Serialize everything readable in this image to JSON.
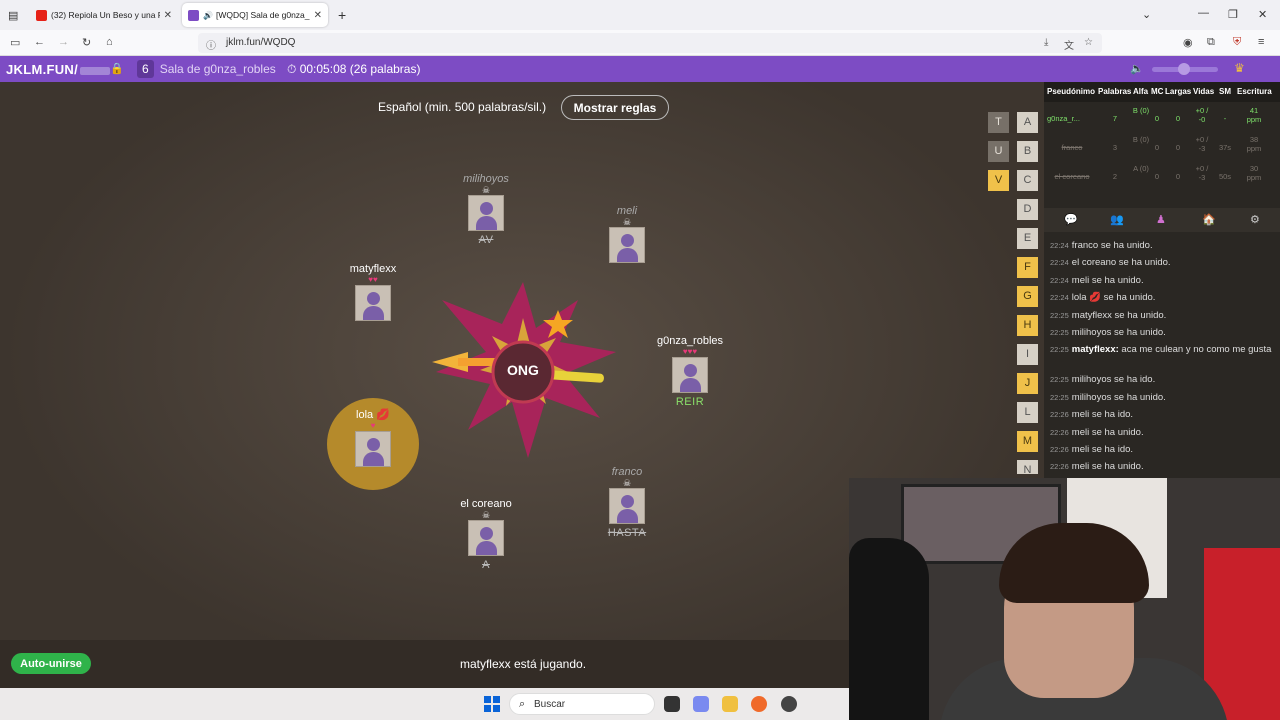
{
  "browser": {
    "tabs": [
      {
        "title": "(32) Repiola Un Beso y una Flor",
        "favicon_color": "#e62117",
        "active": false
      },
      {
        "title": "[WQDQ] Sala de g0nza_robles",
        "favicon_color": "#7d4cc4",
        "active": true
      }
    ],
    "url": "jklm.fun/WQDQ"
  },
  "gamebar": {
    "brand": "JKLM.FUN/",
    "player_count": "6",
    "room_name": "Sala de g0nza_robles",
    "timer": "00:05:08 (26 palabras)"
  },
  "game": {
    "language_label": "Español (min. 500 palabras/sil.)",
    "rules_button": "Mostrar reglas",
    "syllable": "ONG",
    "players": [
      {
        "name": "milihoyos",
        "dead": true,
        "hearts": "",
        "word": "AV"
      },
      {
        "name": "meli",
        "dead": true,
        "hearts": "",
        "word": ""
      },
      {
        "name": "matyflexx",
        "dead": false,
        "hearts": "♥♥",
        "word": ""
      },
      {
        "name": "g0nza_robles",
        "dead": false,
        "hearts": "♥♥♥",
        "word": "REIR"
      },
      {
        "name": "lola 💋",
        "dead": false,
        "hearts": "♥",
        "word": ""
      },
      {
        "name": "franco",
        "dead": true,
        "hearts": "",
        "word": "HASTA"
      },
      {
        "name": "el coreano",
        "dead": true,
        "hearts": "",
        "word": "A"
      }
    ],
    "letters_col1": [
      "T",
      "U",
      "V"
    ],
    "letters_col2": [
      "A",
      "B",
      "C",
      "D",
      "E",
      "F",
      "G",
      "H",
      "I",
      "J",
      "L",
      "M",
      "N"
    ],
    "used_col1": [
      "V"
    ],
    "used_col2": [
      "F",
      "G",
      "H",
      "J",
      "M"
    ],
    "autojoin": "Auto-unirse",
    "status": "matyflexx está jugando."
  },
  "scoreboard": {
    "headers": [
      "Pseudónimo",
      "Palabras",
      "Alfa",
      "MC",
      "Largas",
      "Vidas",
      "SM",
      "Escritura"
    ],
    "rows": [
      {
        "name": "g0nza_r...",
        "words": "7",
        "alpha": "B (0)",
        "mc": "0",
        "long": "0",
        "lives": "+0 / -0",
        "sm": "-",
        "speed": "41 ppm",
        "me": true
      },
      {
        "name": "franco",
        "words": "3",
        "alpha": "B (0)",
        "mc": "0",
        "long": "0",
        "lives": "+0 / -3",
        "sm": "37s",
        "speed": "38 ppm",
        "me": false
      },
      {
        "name": "el coreano",
        "words": "2",
        "alpha": "A (0)",
        "mc": "0",
        "long": "0",
        "lives": "+0 / -3",
        "sm": "50s",
        "speed": "30 ppm",
        "me": false
      }
    ]
  },
  "chat": [
    {
      "time": "22:24",
      "user": "",
      "text": "franco se ha unido."
    },
    {
      "time": "22:24",
      "user": "",
      "text": "el coreano se ha unido."
    },
    {
      "time": "22:24",
      "user": "",
      "text": "meli se ha unido."
    },
    {
      "time": "22:24",
      "user": "",
      "text": "lola 💋 se ha unido."
    },
    {
      "time": "22:25",
      "user": "",
      "text": "matyflexx se ha unido."
    },
    {
      "time": "22:25",
      "user": "",
      "text": "milihoyos  se ha unido."
    },
    {
      "time": "22:25",
      "user": "matyflexx:",
      "text": " aca me culean y no como me gusta"
    },
    {
      "time": "22:25",
      "user": "",
      "text": "milihoyos  se ha ido."
    },
    {
      "time": "22:25",
      "user": "",
      "text": "milihoyos  se ha unido."
    },
    {
      "time": "22:26",
      "user": "",
      "text": "meli se ha ido."
    },
    {
      "time": "22:26",
      "user": "",
      "text": "meli se ha unido."
    },
    {
      "time": "22:26",
      "user": "",
      "text": "meli se ha ido."
    },
    {
      "time": "22:26",
      "user": "",
      "text": "meli se ha unido."
    }
  ],
  "taskbar": {
    "search_label": "Buscar"
  },
  "colors": {
    "accent": "#7d4cc4",
    "used_letter": "#f0c14a",
    "autojoin": "#2fb34a"
  }
}
